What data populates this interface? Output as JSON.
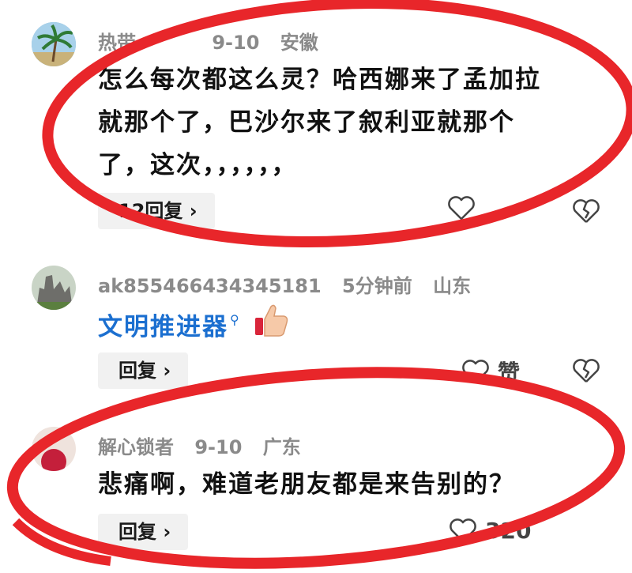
{
  "comments": [
    {
      "user": "热带",
      "date": "9-10",
      "location": "安徽",
      "lines": [
        "怎么每次都这么灵？哈西娜来了孟加拉",
        "就那个了，巴沙尔来了叙利亚就那个",
        "了，这次，，，，，，"
      ],
      "reply_label": "12回复 ›",
      "like_count": ""
    },
    {
      "user": "ak855466434345181",
      "date": "5分钟前",
      "location": "山东",
      "text": "文明推进器",
      "search_mark": "⚲",
      "reply_label": "回复 ›",
      "like_label": "赞"
    },
    {
      "user": "解心锁者",
      "date": "9-10",
      "location": "广东",
      "text": "悲痛啊，难道老朋友都是来告别的？",
      "reply_label": "回复 ›",
      "like_count": "320"
    }
  ],
  "colors": {
    "annotation": "#e8262a",
    "link": "#1b6fd0",
    "meta": "#8a8a8a"
  }
}
